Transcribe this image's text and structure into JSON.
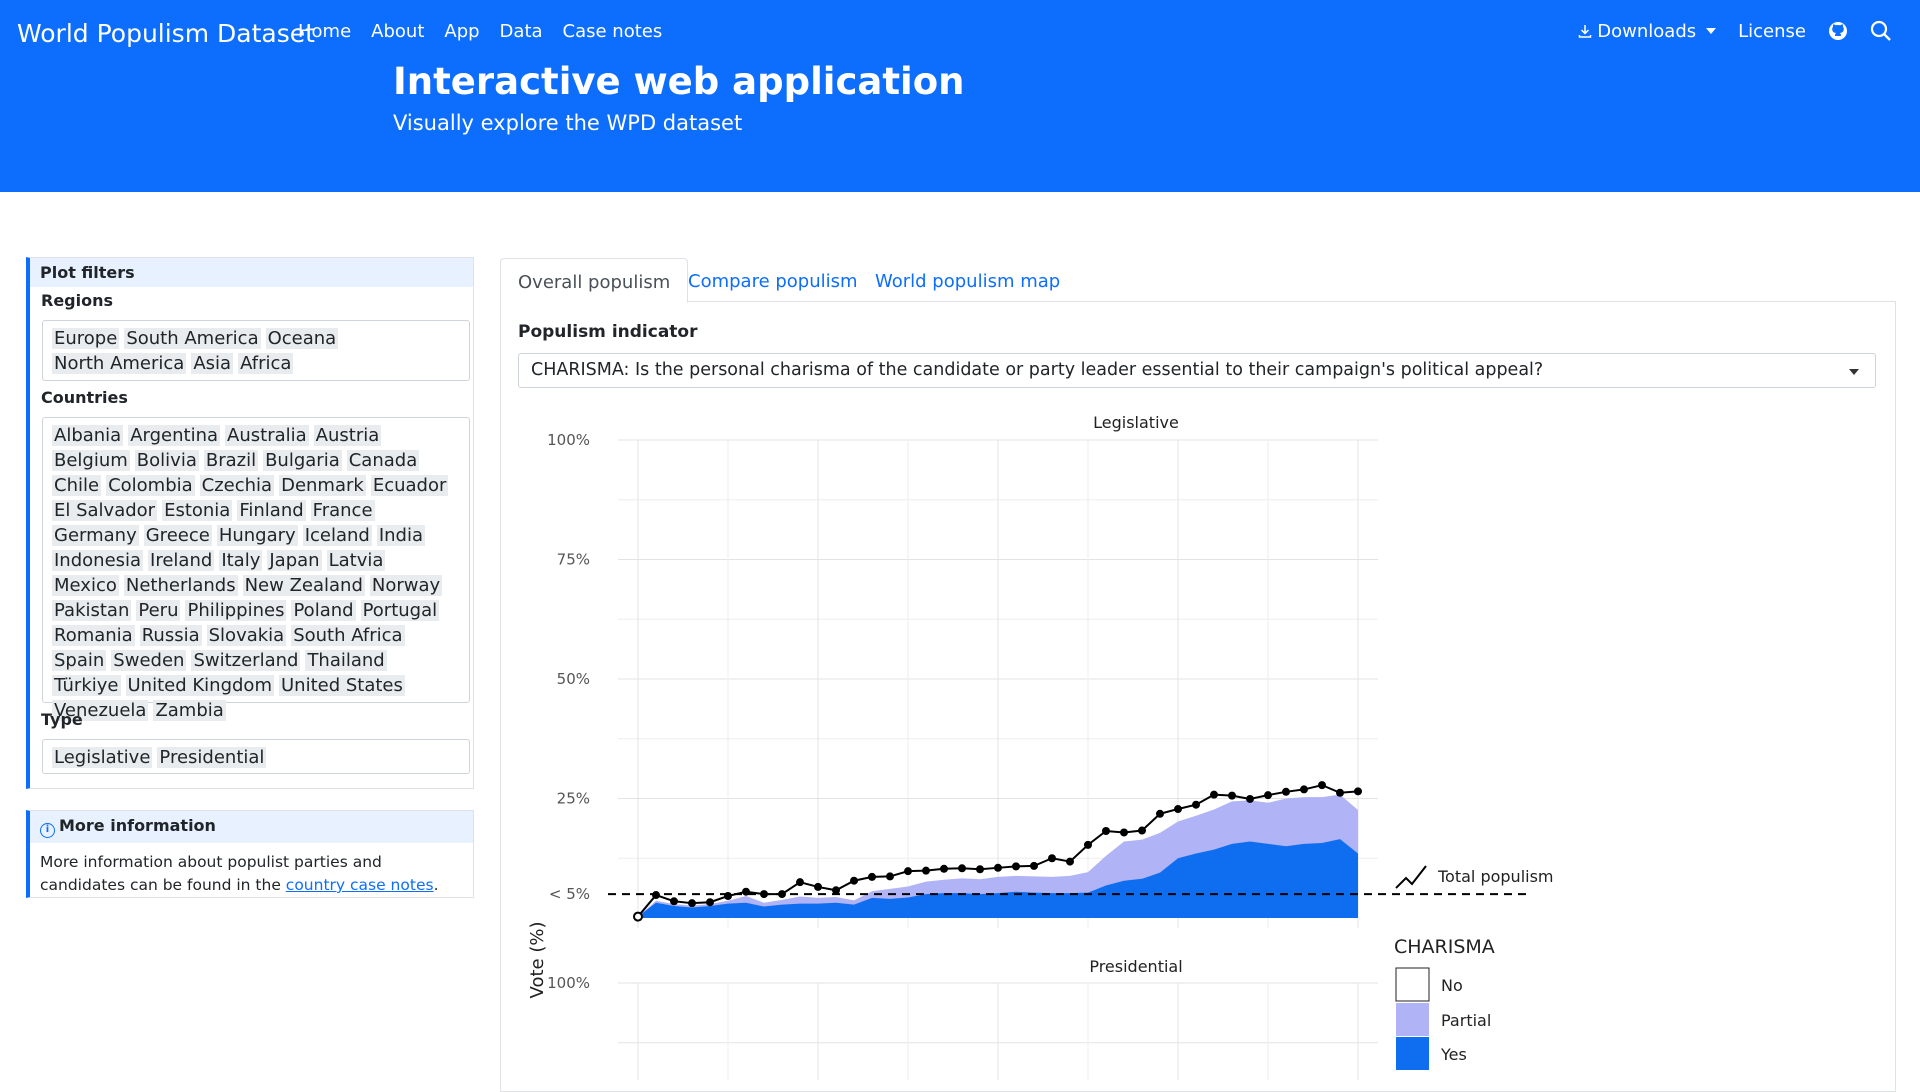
{
  "header": {
    "brand": "World Populism Dataset",
    "nav": [
      "Home",
      "About",
      "App",
      "Data",
      "Case notes"
    ],
    "downloads": "Downloads",
    "license": "License",
    "hero_title": "Interactive web application",
    "hero_subtitle": "Visually explore the WPD dataset"
  },
  "filters": {
    "title": "Plot filters",
    "regions_label": "Regions",
    "regions": [
      "Europe",
      "South America",
      "Oceana",
      "North America",
      "Asia",
      "Africa"
    ],
    "countries_label": "Countries",
    "countries": [
      "Albania",
      "Argentina",
      "Australia",
      "Austria",
      "Belgium",
      "Bolivia",
      "Brazil",
      "Bulgaria",
      "Canada",
      "Chile",
      "Colombia",
      "Czechia",
      "Denmark",
      "Ecuador",
      "El Salvador",
      "Estonia",
      "Finland",
      "France",
      "Germany",
      "Greece",
      "Hungary",
      "Iceland",
      "India",
      "Indonesia",
      "Ireland",
      "Italy",
      "Japan",
      "Latvia",
      "Mexico",
      "Netherlands",
      "New Zealand",
      "Norway",
      "Pakistan",
      "Peru",
      "Philippines",
      "Poland",
      "Portugal",
      "Romania",
      "Russia",
      "Slovakia",
      "South Africa",
      "Spain",
      "Sweden",
      "Switzerland",
      "Thailand",
      "Türkiye",
      "United Kingdom",
      "United States",
      "Venezuela",
      "Zambia"
    ],
    "type_label": "Type",
    "types": [
      "Legislative",
      "Presidential"
    ]
  },
  "more_info": {
    "title": "More information",
    "text_before": "More information about populist parties and candidates can be found in the ",
    "link": "country case notes",
    "text_after": "."
  },
  "tabs": [
    "Overall populism",
    "Compare populism",
    "World populism map"
  ],
  "indicator": {
    "label": "Populism indicator",
    "selected": "CHARISMA: Is the personal charisma of the candidate or party leader essential to their campaign's political appeal?"
  },
  "colors": {
    "brand": "#0d6efd",
    "yes": "#0f6ef0",
    "partial": "#b0b3f5",
    "no": "#ffffff"
  },
  "chart_data": {
    "type": "area",
    "panels": [
      "Legislative",
      "Presidential"
    ],
    "ylabel": "Vote (%)",
    "yticks": [
      "100%",
      "75%",
      "50%",
      "25%",
      "< 5%"
    ],
    "ylim": [
      0,
      100
    ],
    "threshold": 5,
    "x_count": 41,
    "series": [
      {
        "name": "Yes",
        "values": [
          0.3,
          3.2,
          2.5,
          2.2,
          2.5,
          3.0,
          3.2,
          2.4,
          2.8,
          3.0,
          3.0,
          3.2,
          2.8,
          4.2,
          4.0,
          4.3,
          5.0,
          5.2,
          5.2,
          5.0,
          5.2,
          5.5,
          5.3,
          5.2,
          5.2,
          5.3,
          6.8,
          7.8,
          8.2,
          9.5,
          12.5,
          13.5,
          14.3,
          15.5,
          16.0,
          15.5,
          15.0,
          15.5,
          15.7,
          16.5,
          13.5,
          12.5
        ]
      },
      {
        "name": "Partial",
        "values": [
          0.3,
          3.6,
          2.9,
          2.6,
          2.9,
          3.6,
          4.6,
          3.2,
          3.8,
          4.5,
          4.2,
          4.4,
          3.7,
          5.6,
          6.1,
          6.6,
          7.6,
          8.0,
          8.3,
          8.1,
          8.6,
          8.8,
          8.7,
          8.6,
          8.8,
          9.6,
          13.0,
          16.0,
          16.4,
          17.8,
          20.2,
          21.4,
          22.7,
          24.4,
          24.6,
          24.1,
          25.0,
          25.3,
          25.3,
          25.8,
          22.6,
          22.5
        ]
      },
      {
        "name": "Total populism",
        "values": [
          0.3,
          4.8,
          3.5,
          3.1,
          3.3,
          4.6,
          5.5,
          5.0,
          5.0,
          7.5,
          6.5,
          5.8,
          7.8,
          8.6,
          8.7,
          9.8,
          9.9,
          10.3,
          10.4,
          10.2,
          10.5,
          10.8,
          10.9,
          12.5,
          11.8,
          15.3,
          18.2,
          17.9,
          18.3,
          21.8,
          22.8,
          23.7,
          25.8,
          25.6,
          24.9,
          25.7,
          26.4,
          26.9,
          27.8,
          26.2,
          26.5
        ]
      }
    ],
    "legend": {
      "line": "Total populism",
      "fill_title": "CHARISMA",
      "fill_items": [
        "No",
        "Partial",
        "Yes"
      ],
      "placement": "right"
    }
  }
}
